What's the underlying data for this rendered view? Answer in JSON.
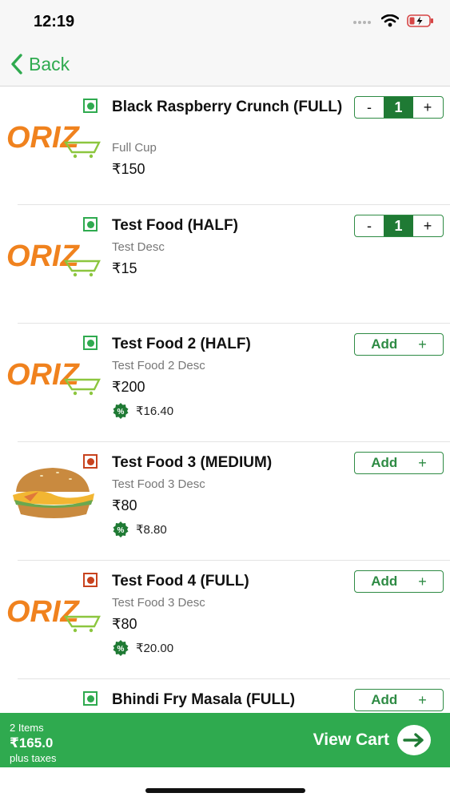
{
  "status": {
    "time": "12:19"
  },
  "nav": {
    "back_label": "Back"
  },
  "currency": "₹",
  "items": [
    {
      "name": "Black Raspberry Crunch (FULL)",
      "desc": "Full Cup",
      "price": "₹150",
      "discount": "",
      "veg": true,
      "image": "oriz-logo",
      "quantity": "1"
    },
    {
      "name": "Test Food (HALF)",
      "desc": "Test Desc",
      "price": "₹15",
      "discount": "",
      "veg": true,
      "image": "oriz-logo",
      "quantity": "1"
    },
    {
      "name": "Test Food 2 (HALF)",
      "desc": "Test Food 2 Desc",
      "price": "₹200",
      "discount": "₹16.40",
      "veg": true,
      "image": "oriz-logo",
      "add_label": "Add"
    },
    {
      "name": "Test Food 3 (MEDIUM)",
      "desc": "Test Food 3 Desc",
      "price": "₹80",
      "discount": "₹8.80",
      "veg": false,
      "image": "burger-photo",
      "add_label": "Add"
    },
    {
      "name": "Test Food 4 (FULL)",
      "desc": "Test Food 3 Desc",
      "price": "₹80",
      "discount": "₹20.00",
      "veg": false,
      "image": "oriz-logo",
      "add_label": "Add"
    },
    {
      "name": "Bhindi Fry Masala (FULL)",
      "desc": "",
      "price": "",
      "discount": "",
      "veg": true,
      "image": "",
      "add_label": "Add"
    }
  ],
  "stepper": {
    "minus": "-",
    "plus": "+"
  },
  "logo_text": "ORIZ",
  "cart": {
    "count": "2 Items",
    "total": "₹165.0",
    "taxes": "plus taxes",
    "view_label": "View Cart"
  },
  "colors": {
    "brand_green": "#2faa4f",
    "dark_green": "#1f7a34",
    "logo_orange": "#f0821e",
    "nonveg_red": "#c8421e"
  },
  "icons": [
    "signal-icon",
    "wifi-icon",
    "battery-icon",
    "back-chevron-icon",
    "veg-icon",
    "nonveg-icon",
    "discount-icon",
    "arrow-right-icon"
  ]
}
